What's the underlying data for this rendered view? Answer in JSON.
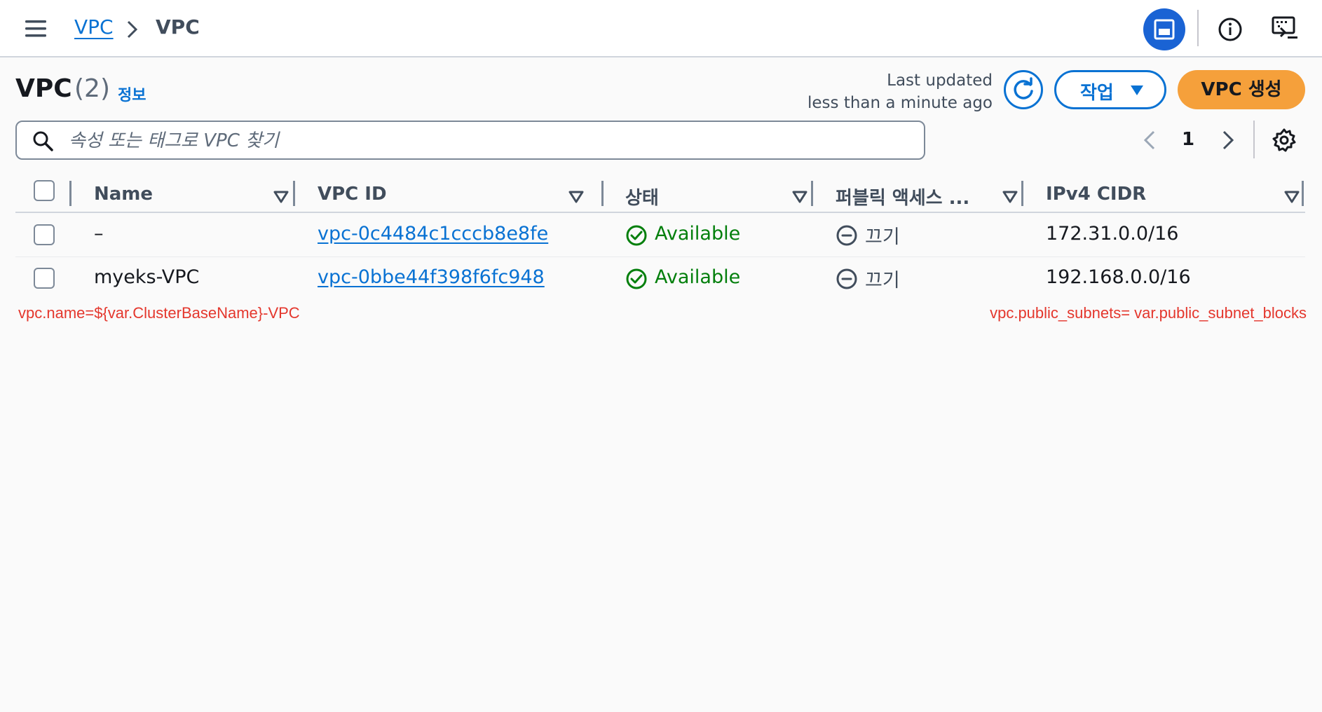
{
  "breadcrumb": {
    "parent": "VPC",
    "current": "VPC"
  },
  "page": {
    "title": "VPC",
    "count": "(2)",
    "info_link": "정보"
  },
  "last_updated": {
    "line1": "Last updated",
    "line2": "less than a minute ago"
  },
  "actions": {
    "label": "작업",
    "create_label": "VPC 생성"
  },
  "search": {
    "placeholder": "속성 또는 태그로 VPC 찾기",
    "value": ""
  },
  "pagination": {
    "current_page": "1"
  },
  "table": {
    "columns": [
      "Name",
      "VPC ID",
      "상태",
      "퍼블릭 액세스 ...",
      "IPv4 CIDR"
    ],
    "rows": [
      {
        "name": "–",
        "vpc_id": "vpc-0c4484c1cccb8e8fe",
        "status": "Available",
        "public_access": "끄기",
        "ipv4_cidr": "172.31.0.0/16"
      },
      {
        "name": "myeks-VPC",
        "vpc_id": "vpc-0bbe44f398f6fc948",
        "status": "Available",
        "public_access": "끄기",
        "ipv4_cidr": "192.168.0.0/16"
      }
    ]
  },
  "annotations": {
    "name_note": "vpc.name=${var.ClusterBaseName}-VPC",
    "subnet_note": "vpc.public_subnets= var.public_subnet_blocks"
  },
  "colors": {
    "link": "#0972d3",
    "primary_button": "#f5a03b",
    "status_available": "#037f0c",
    "annotation": "#e4372d",
    "active_toggle": "#1a63d4"
  },
  "icons": [
    "menu-icon",
    "chevron-right-icon",
    "split-panel-icon",
    "info-icon",
    "feedback-icon",
    "refresh-icon",
    "caret-down-icon",
    "search-icon",
    "chevron-left-icon",
    "gear-icon",
    "check-circle-icon",
    "minus-circle-icon"
  ]
}
